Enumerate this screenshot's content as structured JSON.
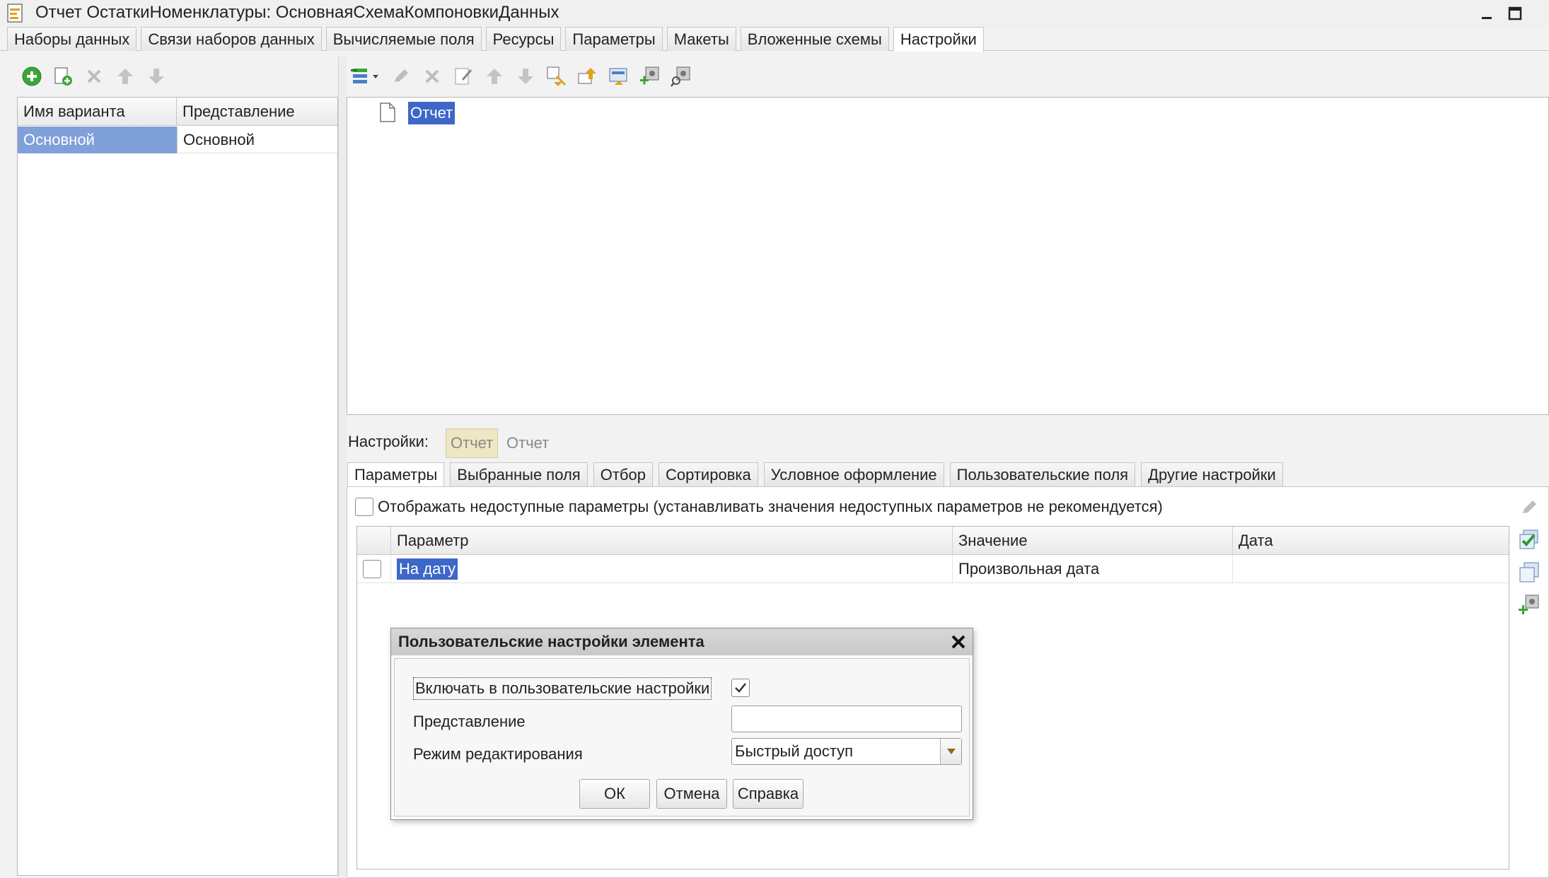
{
  "window": {
    "title": "Отчет ОстаткиНоменклатуры: ОсновнаяСхемаКомпоновкиДанных"
  },
  "top_tabs": [
    {
      "label": "Наборы данных"
    },
    {
      "label": "Связи наборов данных"
    },
    {
      "label": "Вычисляемые поля"
    },
    {
      "label": "Ресурсы"
    },
    {
      "label": "Параметры"
    },
    {
      "label": "Макеты"
    },
    {
      "label": "Вложенные схемы"
    },
    {
      "label": "Настройки",
      "active": true
    }
  ],
  "variants": {
    "columns": [
      "Имя варианта",
      "Представление"
    ],
    "rows": [
      {
        "name": "Основной",
        "presentation": "Основной"
      }
    ]
  },
  "tree": {
    "root_label": "Отчет"
  },
  "settings": {
    "label": "Настройки:",
    "chips": [
      "Отчет",
      "Отчет"
    ],
    "tabs": [
      {
        "label": "Параметры",
        "active": true
      },
      {
        "label": "Выбранные поля"
      },
      {
        "label": "Отбор"
      },
      {
        "label": "Сортировка"
      },
      {
        "label": "Условное оформление"
      },
      {
        "label": "Пользовательские поля"
      },
      {
        "label": "Другие настройки"
      }
    ],
    "show_unavailable_label": "Отображать недоступные параметры (устанавливать значения недоступных параметров не рекомендуется)",
    "show_unavailable_checked": false
  },
  "params_table": {
    "columns": [
      "Параметр",
      "Значение",
      "Дата"
    ],
    "rows": [
      {
        "checked": false,
        "param": "На дату",
        "value": "Произвольная дата",
        "date": ""
      }
    ]
  },
  "dialog": {
    "title": "Пользовательские настройки элемента",
    "include_label": "Включать в пользовательские настройки",
    "include_checked": true,
    "presentation_label": "Представление",
    "presentation_value": "",
    "edit_mode_label": "Режим редактирования",
    "edit_mode_value": "Быстрый доступ",
    "ok_label": "ОК",
    "cancel_label": "Отмена",
    "help_label": "Справка"
  },
  "colors": {
    "selection": "#3d67c8",
    "selection_light": "#7fa0d9",
    "add_green": "#3aa53a"
  }
}
